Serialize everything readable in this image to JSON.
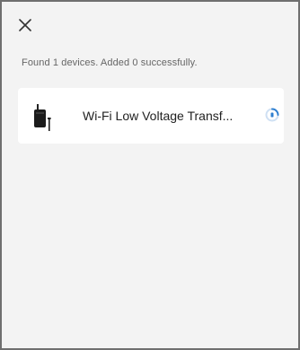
{
  "header": {
    "close_icon": "close-icon"
  },
  "status": {
    "message": "Found 1 devices. Added 0 successfully."
  },
  "devices": [
    {
      "name": "Wi-Fi Low Voltage Transf...",
      "icon": "transformer-device-icon",
      "state_icon": "loading-spinner-icon"
    }
  ],
  "colors": {
    "background": "#f3f3f3",
    "card": "#ffffff",
    "accent": "#2f7fd0",
    "text": "#222222",
    "subtext": "#666666"
  }
}
